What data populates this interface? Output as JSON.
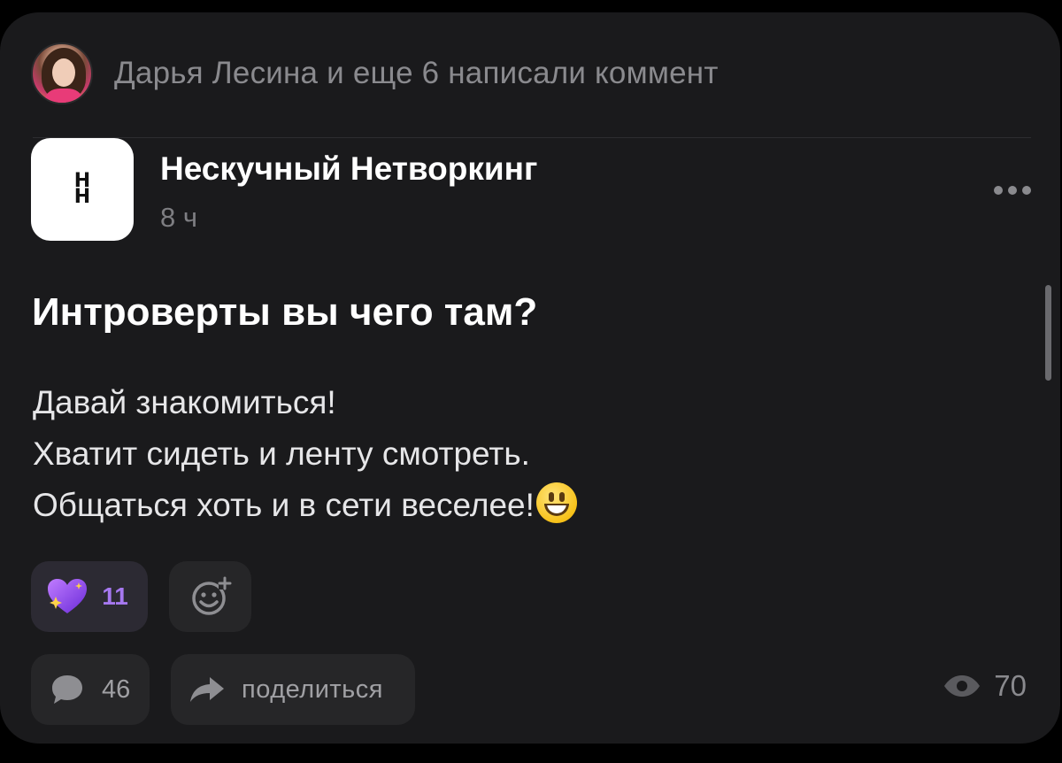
{
  "activity": {
    "text": "Дарья Лесина и еще 6 написали коммент"
  },
  "author": {
    "name": "Нескучный Нетворкинг",
    "time": "8 ч"
  },
  "post": {
    "title": "Интроверты вы чего там?",
    "lines": [
      "Давай знакомиться!",
      "Хватит сидеть и ленту смотреть.",
      "Общаться хоть и в сети веселее!"
    ],
    "emoji": "smiling-face-emoji"
  },
  "reactions": {
    "heart_count": "11",
    "heart_icon": "sparkling-heart-icon",
    "add_icon": "add-reaction-icon"
  },
  "actions": {
    "comments_count": "46",
    "share_label": "поделиться",
    "views_count": "70"
  },
  "colors": {
    "background": "#000000",
    "card": "#1a1a1c",
    "button": "#262628",
    "accent_purple": "#a678f0",
    "muted_text": "#8a8a8e"
  }
}
